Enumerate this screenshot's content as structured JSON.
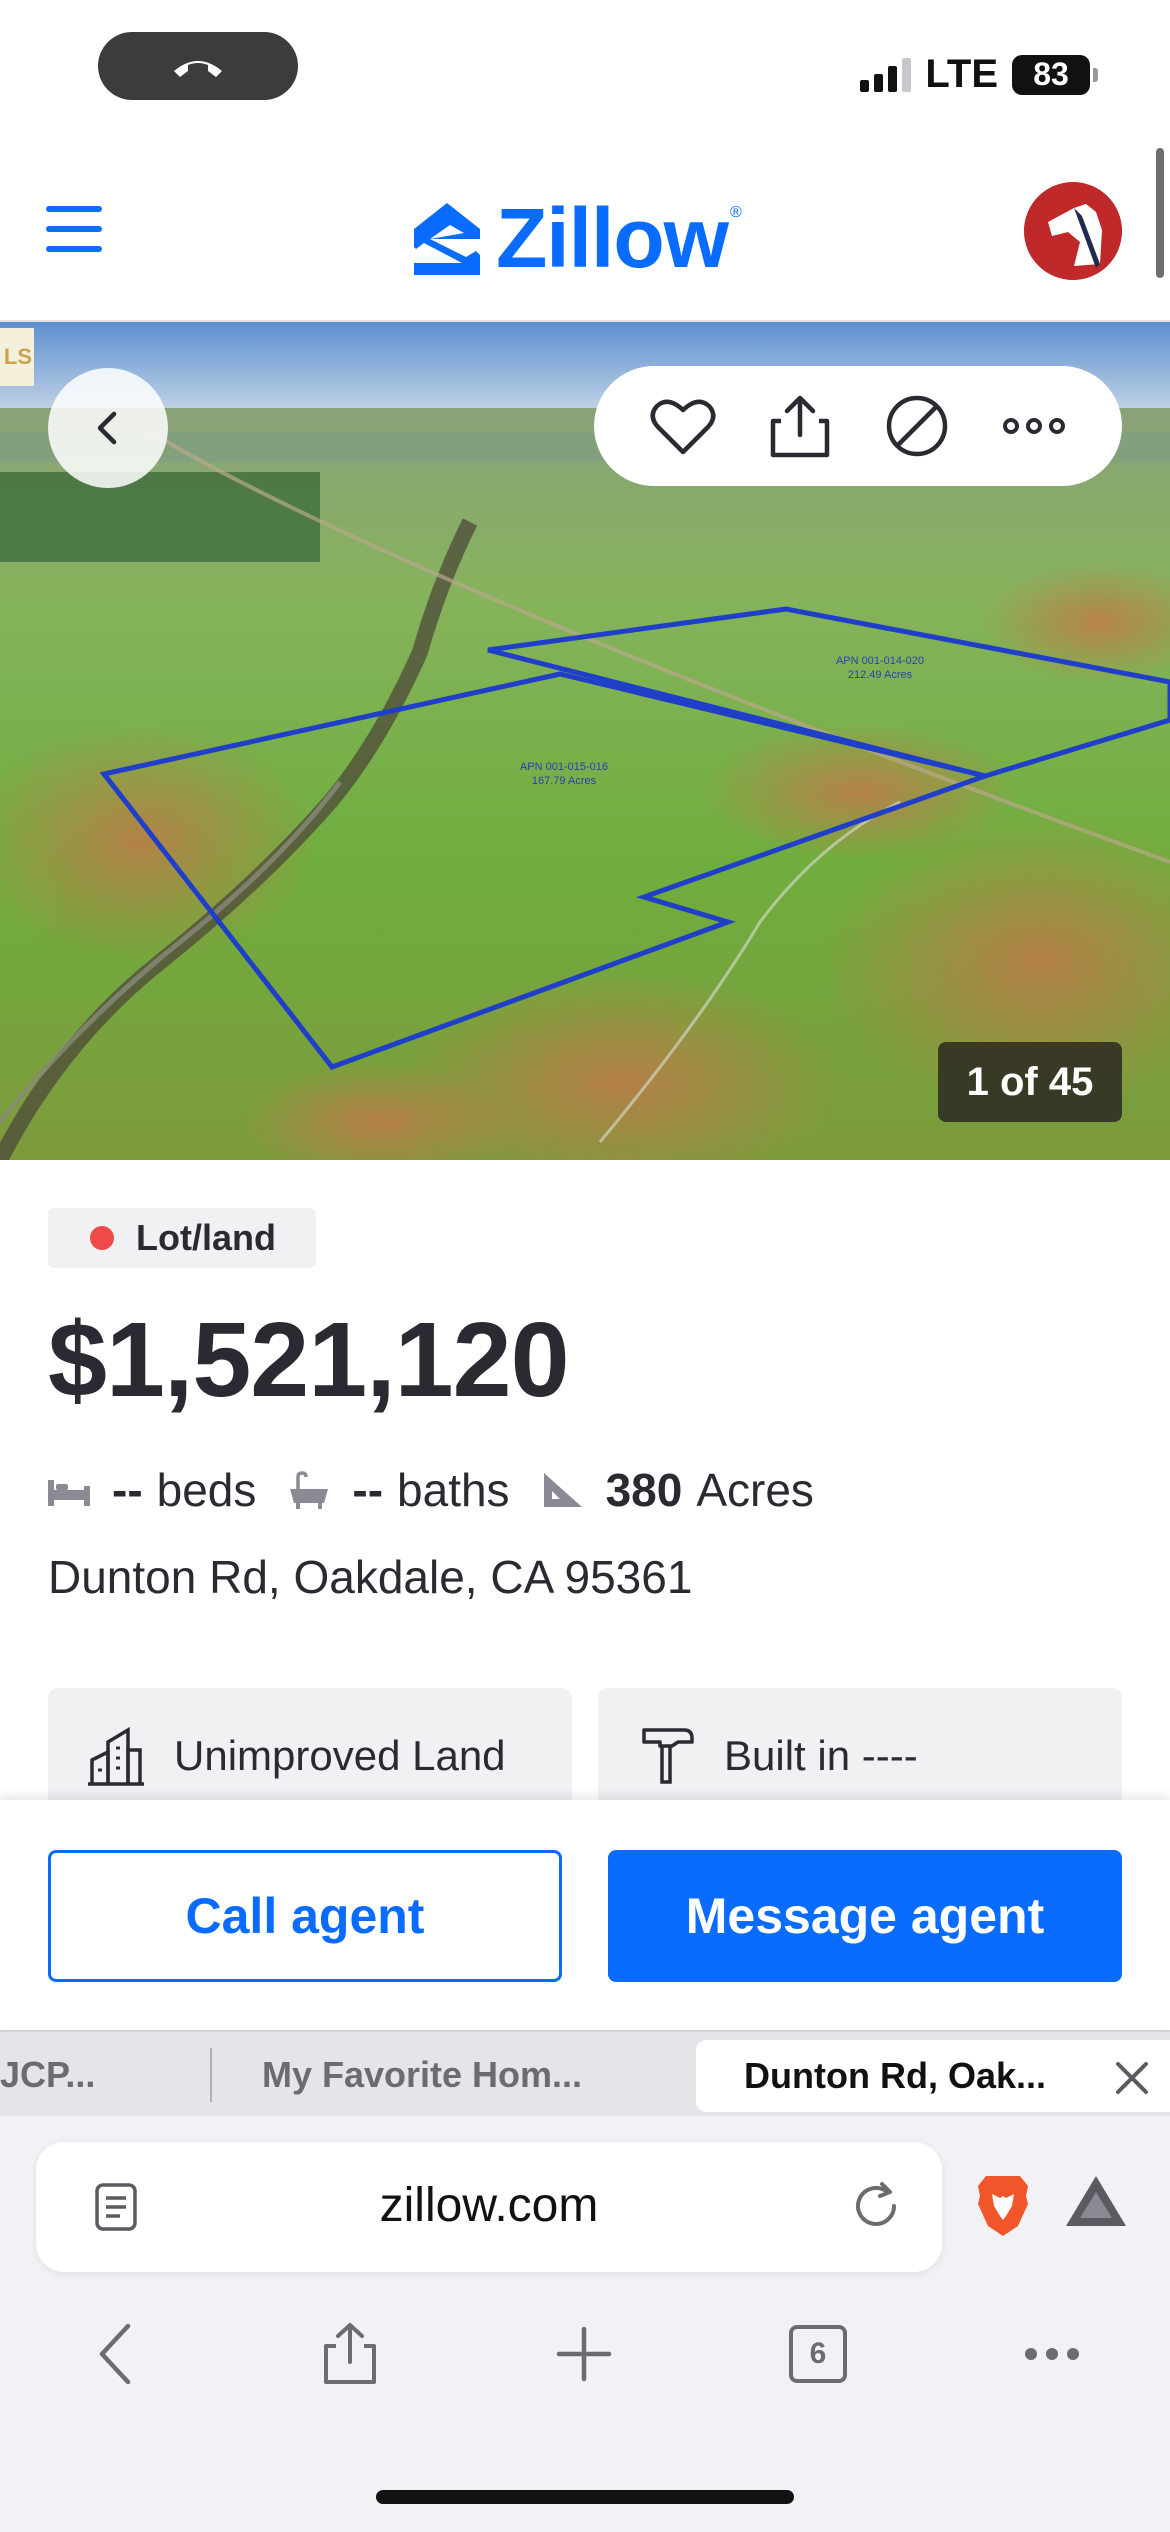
{
  "status_bar": {
    "network": "LTE",
    "battery": "83"
  },
  "header": {
    "brand": "Zillow"
  },
  "gallery": {
    "photo_counter": "1 of 45",
    "mls_tag": "LS",
    "overlay_labels": [
      {
        "apn": "APN 001-015-016",
        "acres": "167.79 Acres"
      },
      {
        "apn": "APN 001-014-020",
        "acres": "212.49 Acres"
      }
    ]
  },
  "listing": {
    "type_badge": "Lot/land",
    "price": "$1,521,120",
    "beds_value": "--",
    "beds_label": "beds",
    "baths_value": "--",
    "baths_label": "baths",
    "area_value": "380",
    "area_label": "Acres",
    "address": "Dunton Rd, Oakdale, CA 95361",
    "fact_cards": [
      {
        "label": "Unimproved Land",
        "icon": "building-icon"
      },
      {
        "label": "Built in ----",
        "icon": "hammer-icon"
      }
    ]
  },
  "cta": {
    "call_label": "Call agent",
    "message_label": "Message agent"
  },
  "browser": {
    "tabs": [
      {
        "title": "JCP..."
      },
      {
        "title": "My Favorite Hom..."
      },
      {
        "title": "Dunton Rd, Oak...",
        "active": true
      }
    ],
    "url": "zillow.com",
    "open_tabs_count": "6"
  },
  "colors": {
    "brand_blue": "#0a6cff",
    "badge_dot": "#ef4a4a",
    "parcel_outline": "#1f3fc8"
  }
}
